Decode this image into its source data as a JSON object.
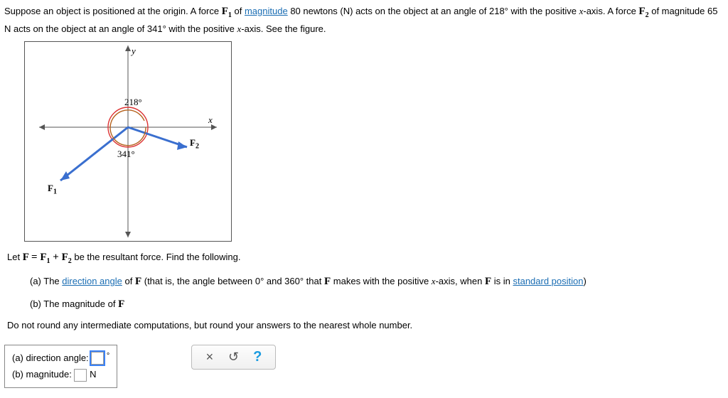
{
  "intro": {
    "t1": "Suppose an object is positioned at the origin. A force ",
    "F1": "F",
    "F1sub": "1",
    "t2": " of ",
    "magnitude_link": "magnitude",
    "t3": " 80 newtons (N) acts on the object at an angle of 218° with the positive ",
    "xvar1": "x",
    "t4": "-axis. A force ",
    "F2": "F",
    "F2sub": "2",
    "t5": " of magnitude 65 N acts on the object at an angle of 341° with the positive ",
    "xvar2": "x",
    "t6": "-axis. See the figure."
  },
  "figure": {
    "angle1": "218°",
    "angle2": "341°",
    "F1lbl": "F",
    "F1sub": "1",
    "F2lbl": "F",
    "F2sub": "2",
    "xlbl": "x",
    "ylbl": "y"
  },
  "let_line": {
    "t1": "Let ",
    "eq": "F = F",
    "sub1": "1",
    "plus": " + F",
    "sub2": "2",
    "t2": " be the resultant force. Find the following."
  },
  "parts": {
    "a": {
      "prefix": "(a) The ",
      "link": "direction angle",
      "mid": " of ",
      "Fb": "F",
      "t1": " (that is, the angle between 0° and 360° that ",
      "Fb2": "F",
      "t2": " makes with the positive ",
      "xvar": "x",
      "t3": "-axis, when ",
      "Fb3": "F",
      "t4": " is in ",
      "link2": "standard position",
      "t5": ")"
    },
    "b": {
      "prefix": "(b) The magnitude of ",
      "Fb": "F"
    }
  },
  "noround": "Do not round any intermediate computations, but round your answers to the nearest whole number.",
  "answers": {
    "a_label": "(a) direction angle: ",
    "a_value": "",
    "a_unit": "°",
    "b_label": "(b) magnitude: ",
    "b_value": "",
    "b_unit": "N"
  },
  "toolbar": {
    "clear": "×",
    "undo": "↺",
    "help": "?"
  }
}
